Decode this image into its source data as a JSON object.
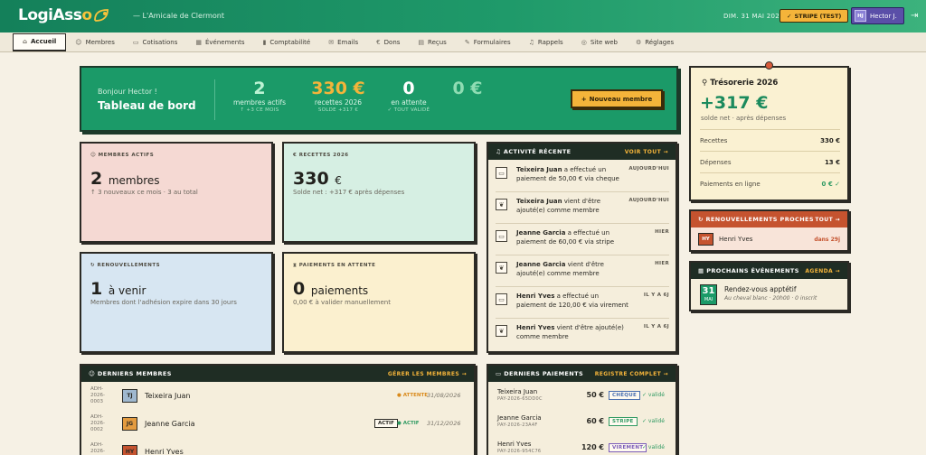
{
  "app": {
    "logo_main": "LogiAss",
    "logo_o": "o",
    "org": "— L'Amicale de Clermont",
    "date": "DIM. 31 MAI 2026",
    "stripe_chip": "STRIPE (TEST)",
    "user_initials": "HJ",
    "user_name": "Hector J."
  },
  "nav": [
    {
      "label": "Accueil",
      "icon": "home-icon",
      "glyph": "⌂"
    },
    {
      "label": "Membres",
      "icon": "users-icon",
      "glyph": "☺"
    },
    {
      "label": "Cotisations",
      "icon": "card-icon",
      "glyph": "▭"
    },
    {
      "label": "Événements",
      "icon": "calendar-icon",
      "glyph": "▦"
    },
    {
      "label": "Comptabilité",
      "icon": "chart-icon",
      "glyph": "▮"
    },
    {
      "label": "Emails",
      "icon": "mail-icon",
      "glyph": "✉"
    },
    {
      "label": "Dons",
      "icon": "euro-icon",
      "glyph": "€"
    },
    {
      "label": "Reçus",
      "icon": "receipt-icon",
      "glyph": "▤"
    },
    {
      "label": "Formulaires",
      "icon": "form-icon",
      "glyph": "✎"
    },
    {
      "label": "Rappels",
      "icon": "bell-icon",
      "glyph": "♫"
    },
    {
      "label": "Site web",
      "icon": "globe-icon",
      "glyph": "◎"
    },
    {
      "label": "Réglages",
      "icon": "gear-icon",
      "glyph": "⚙"
    }
  ],
  "hero": {
    "greeting": "Bonjour Hector !",
    "title": "Tableau de bord",
    "kpis": [
      {
        "value": "2",
        "label": "membres actifs",
        "sub": "↑ +3 CE MOIS",
        "color": "#bdf3d4"
      },
      {
        "value": "330 €",
        "label": "recettes 2026",
        "sub": "SOLDE +317 €",
        "color": "#f4b43a"
      },
      {
        "value": "0",
        "label": "en attente",
        "sub": "✓ TOUT VALIDÉ",
        "color": "#ffffff"
      },
      {
        "value": "0 €",
        "label": "",
        "sub": "",
        "color": "#8fdcb3"
      }
    ],
    "new_member_btn": "Nouveau membre"
  },
  "cards": {
    "members": {
      "label": "MEMBRES ACTIFS",
      "value": "2",
      "unit": "membres",
      "sub": "↑ 3 nouveaux ce mois · 3 au total"
    },
    "revenue": {
      "label": "RECETTES 2026",
      "value": "330",
      "unit": "€",
      "sub": "Solde net : +317 € après dépenses"
    },
    "renewals": {
      "label": "RENOUVELLEMENTS",
      "value": "1",
      "unit": "à venir",
      "sub": "Membres dont l'adhésion expire dans 30 jours"
    },
    "pending": {
      "label": "PAIEMENTS EN ATTENTE",
      "value": "0",
      "unit": "paiements",
      "sub": "0,00 € à valider manuellement"
    }
  },
  "activity": {
    "title": "ACTIVITÉ RÉCENTE",
    "link": "VOIR TOUT →",
    "items": [
      {
        "name": "Teixeira Juan",
        "text": " a effectué un paiement de 50,00 € via cheque",
        "time": "AUJOURD'HUI",
        "icon": "payment-icon",
        "glyph": "▭"
      },
      {
        "name": "Teixeira Juan",
        "text": " vient d'être ajouté(e) comme membre",
        "time": "AUJOURD'HUI",
        "icon": "leaf-icon",
        "glyph": "❦"
      },
      {
        "name": "Jeanne Garcia",
        "text": " a effectué un paiement de 60,00 € via stripe",
        "time": "HIER",
        "icon": "payment-icon",
        "glyph": "▭"
      },
      {
        "name": "Jeanne Garcia",
        "text": " vient d'être ajouté(e) comme membre",
        "time": "HIER",
        "icon": "leaf-icon",
        "glyph": "❦"
      },
      {
        "name": "Henri Yves",
        "text": " a effectué un paiement de 120,00 € via virement",
        "time": "IL Y A 6J",
        "icon": "payment-icon",
        "glyph": "▭"
      },
      {
        "name": "Henri Yves",
        "text": " vient d'être ajouté(e) comme membre",
        "time": "IL Y A 6J",
        "icon": "leaf-icon",
        "glyph": "❦"
      }
    ]
  },
  "members_panel": {
    "title": "DERNIERS MEMBRES",
    "link": "GÉRER LES MEMBRES →",
    "rows": [
      {
        "id": "ADH-2026-0003",
        "initials": "TJ",
        "name": "Teixeira Juan",
        "badge": "",
        "status": "● ATTENTE",
        "status_color": "#d98a1c",
        "date": "31/08/2026",
        "av_bg": "#9fb8cf"
      },
      {
        "id": "ADH-2026-0002",
        "initials": "JG",
        "name": "Jeanne Garcia",
        "badge": "ACTIF",
        "status": "● ACTIF",
        "status_color": "#2f9a62",
        "date": "31/12/2026",
        "av_bg": "#e39b3f"
      },
      {
        "id": "ADH-2026-0001",
        "initials": "HY",
        "name": "Henri Yves",
        "badge": "",
        "status": "",
        "status_color": "#2f9a62",
        "date": "",
        "av_bg": "#c5532f"
      }
    ]
  },
  "payments_panel": {
    "title": "DERNIERS PAIEMENTS",
    "link": "REGISTRE COMPLET →",
    "rows": [
      {
        "name": "Teixeira Juan",
        "ref": "PAY-2026-65DD0C",
        "amount": "50 €",
        "method": "CHÈQUE",
        "method_color": "#4a6fb0",
        "valid": "✓ validé"
      },
      {
        "name": "Jeanne Garcia",
        "ref": "PAY-2026-23A4F",
        "amount": "60 €",
        "method": "STRIPE",
        "method_color": "#2f9a62",
        "valid": "✓ validé"
      },
      {
        "name": "Henri Yves",
        "ref": "PAY-2026-954C76",
        "amount": "120 €",
        "method": "VIREMENT",
        "method_color": "#7a5bb8",
        "valid": "✓ validé"
      }
    ]
  },
  "treasury": {
    "title": "Trésorerie 2026",
    "value": "+317 €",
    "sub": "solde net · après dépenses",
    "lines": [
      {
        "label": "Recettes",
        "value": "330 €"
      },
      {
        "label": "Dépenses",
        "value": "13 €"
      },
      {
        "label": "Paiements en ligne",
        "value": "0 € ✓"
      }
    ]
  },
  "renewals_panel": {
    "title": "RENOUVELLEMENTS PROCHES",
    "link": "TOUT →",
    "initials": "HY",
    "name": "Henri Yves",
    "due": "dans 29j"
  },
  "events_panel": {
    "title": "PROCHAINS ÉVÉNEMENTS",
    "link": "AGENDA →",
    "day": "31",
    "month": "MAI",
    "name": "Rendez-vous apptétif",
    "detail": "Au cheval blanc · 20h00 · 0 inscrit"
  }
}
